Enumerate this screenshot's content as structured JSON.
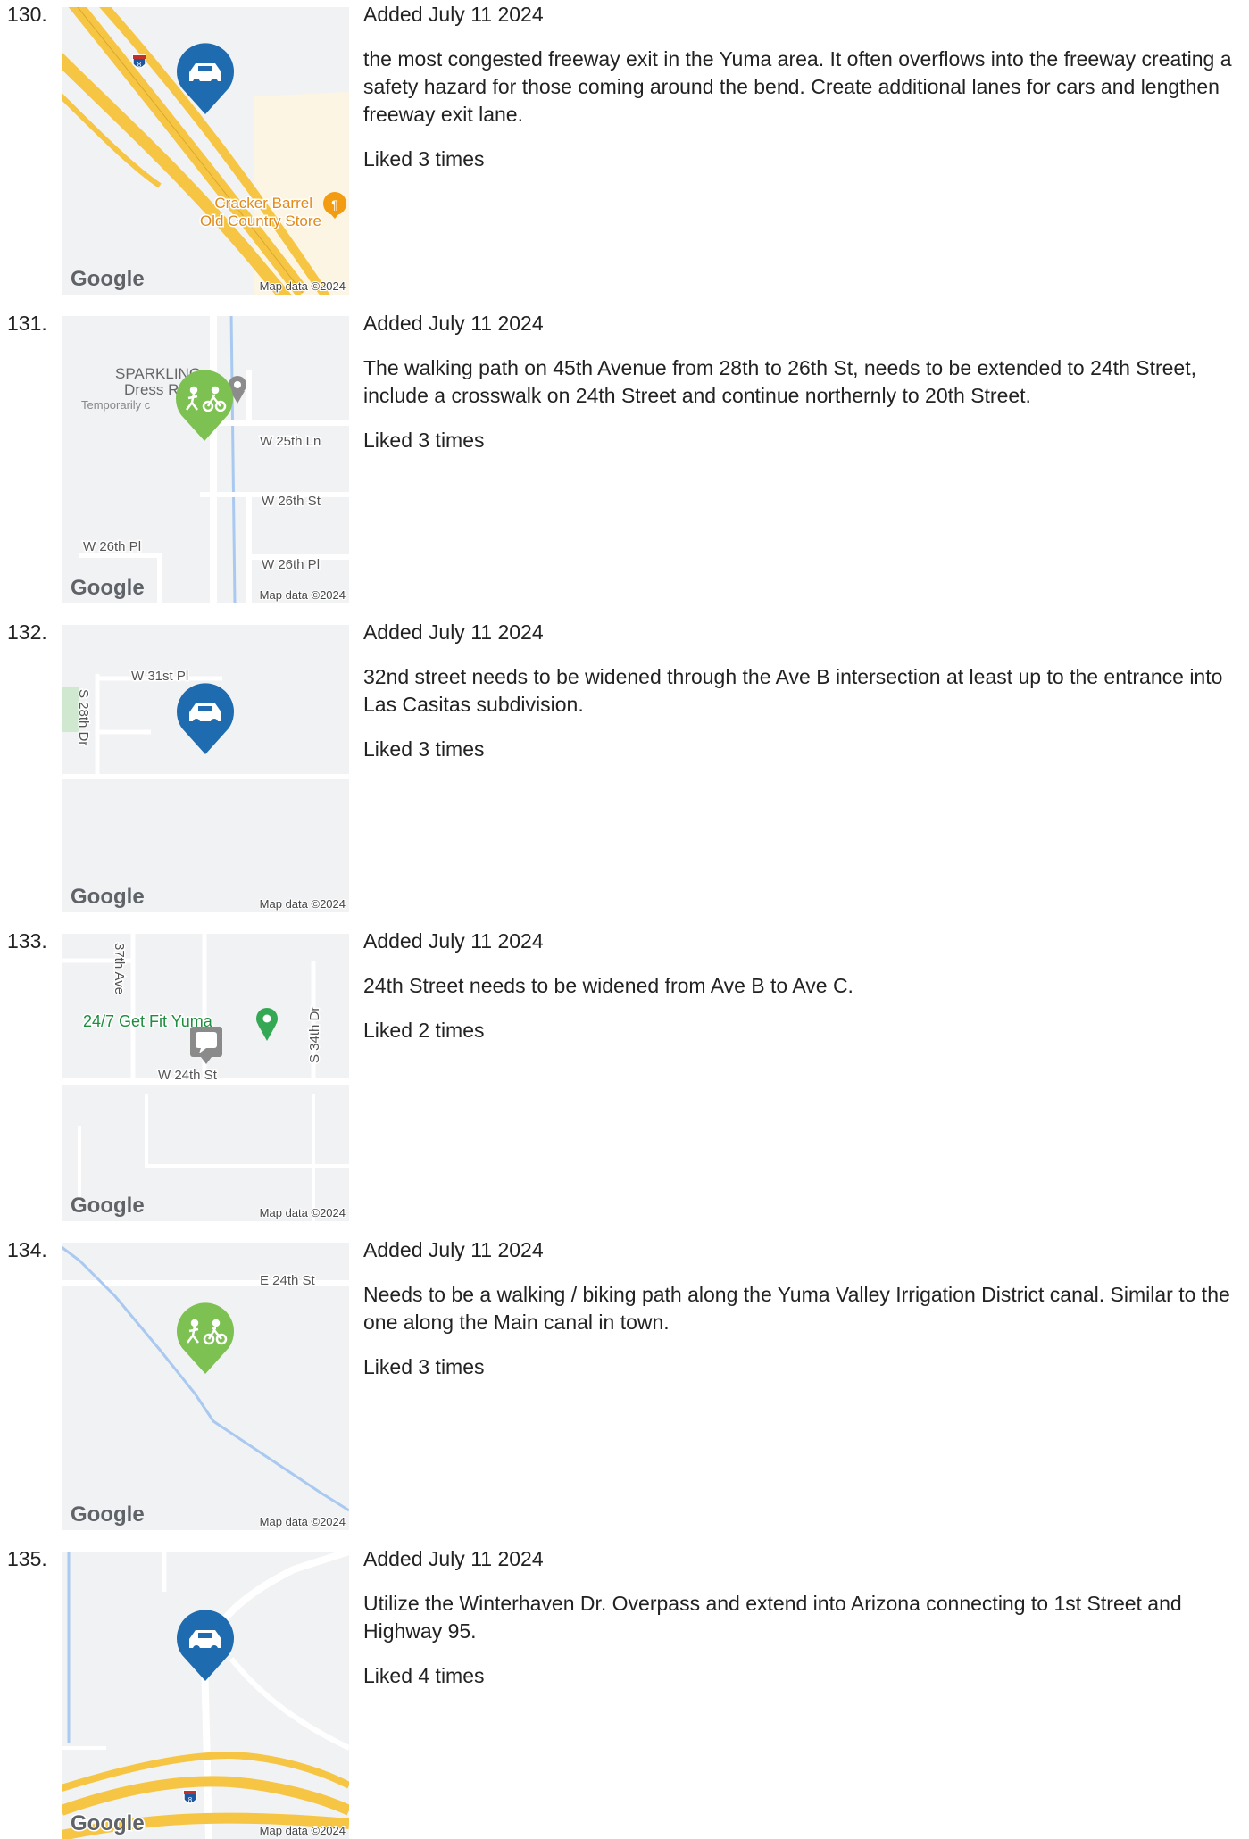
{
  "map_labels": {
    "google": "Google",
    "map_data": "Map data ©2024"
  },
  "entries": [
    {
      "number": "130.",
      "added": "Added July 11 2024",
      "description": "the most congested freeway exit in the Yuma area. It often overflows into the freeway creating a safety hazard for those coming around the bend. Create additional lanes for cars and lengthen freeway exit lane.",
      "likes": "Liked 3 times",
      "marker_icon": "car-icon",
      "map_text": [
        "Cracker Barrel",
        "Old Country Store",
        "8"
      ]
    },
    {
      "number": "131.",
      "added": "Added July 11 2024",
      "description": "The walking path on 45th Avenue from 28th to 26th St, needs to be extended to 24th Street, include a crosswalk on 24th Street and continue northernly to 20th Street.",
      "likes": "Liked 3 times",
      "marker_icon": "pedestrian-bike-icon",
      "map_text": [
        "SPARKLING",
        "Dress Re",
        "Temporarily c",
        "W 25th Ln",
        "W 26th St",
        "W 26th Pl",
        "W 26th Pl"
      ]
    },
    {
      "number": "132.",
      "added": "Added July 11 2024",
      "description": "32nd street needs to be widened through the Ave B intersection at least up to the entrance into Las Casitas subdivision.",
      "likes": "Liked 3 times",
      "marker_icon": "car-icon",
      "map_text": [
        "W 31st Pl",
        "S 28th Dr"
      ]
    },
    {
      "number": "133.",
      "added": "Added July 11 2024",
      "description": "24th Street needs to be widened from Ave B to Ave C.",
      "likes": "Liked 2 times",
      "marker_icon": "comment-icon",
      "map_text": [
        "37th Ave",
        "24/7 Get Fit Yuma",
        "S 34th Dr",
        "W 24th St"
      ]
    },
    {
      "number": "134.",
      "added": "Added July 11 2024",
      "description": "Needs to be a walking / biking path along the Yuma Valley Irrigation District canal. Similar to the one along the Main canal in town.",
      "likes": "Liked 3 times",
      "marker_icon": "pedestrian-bike-icon",
      "map_text": [
        "E 24th St"
      ]
    },
    {
      "number": "135.",
      "added": "Added July 11 2024",
      "description": "Utilize the Winterhaven Dr. Overpass and extend into Arizona connecting to 1st Street and Highway 95.",
      "likes": "Liked 4 times",
      "marker_icon": "car-icon",
      "map_text": [
        "8"
      ]
    }
  ],
  "colors": {
    "car_marker": "#1e6bb0",
    "bike_marker": "#7cc152",
    "comment_marker": "#8a8a8a",
    "freeway": "#f6c544",
    "canal": "#a9c9f0"
  }
}
